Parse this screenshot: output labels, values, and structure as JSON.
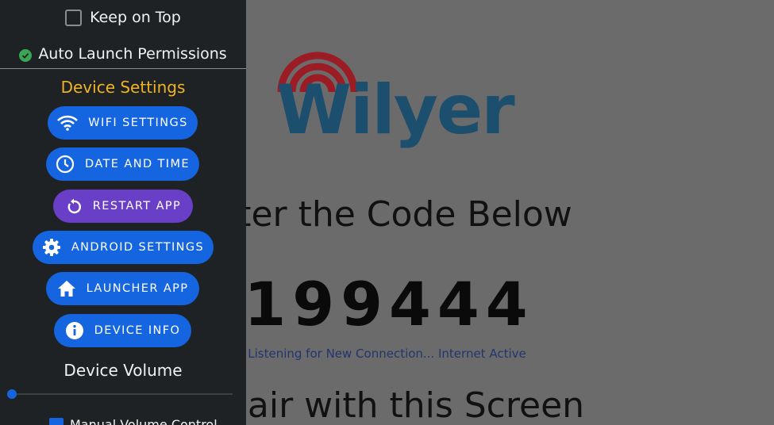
{
  "main": {
    "logo_text": "Wilyer",
    "line_enter": "ter the Code Below",
    "code": "199444",
    "status": "Listening for New Connection... Internet Active",
    "line_pair": "pair with this Screen"
  },
  "panel": {
    "keep_on_top": {
      "label": "Keep on Top",
      "checked": false
    },
    "auto_launch": {
      "label": "Auto Launch Permissions",
      "status": "ok"
    },
    "device_settings_title": "Device Settings",
    "buttons": [
      {
        "label": "WIFI SETTINGS",
        "icon": "wifi-icon"
      },
      {
        "label": "DATE AND TIME",
        "icon": "clock-icon"
      },
      {
        "label": "RESTART APP",
        "icon": "restart-icon"
      },
      {
        "label": "ANDROID SETTINGS",
        "icon": "gear-icon"
      },
      {
        "label": "LAUNCHER APP",
        "icon": "home-icon"
      },
      {
        "label": "DEVICE INFO",
        "icon": "info-icon"
      }
    ],
    "volume_title": "Device Volume",
    "volume_level": 0,
    "manual_volume": {
      "label": "Manual Volume Control",
      "checked": true
    }
  },
  "colors": {
    "panel_bg": "#1f2224",
    "accent_blue": "#1565e0",
    "accent_purple": "#6a3fc8",
    "section_title": "#f0b323",
    "logo_blue": "#1c4e6e",
    "logo_red": "#9b1c24"
  }
}
